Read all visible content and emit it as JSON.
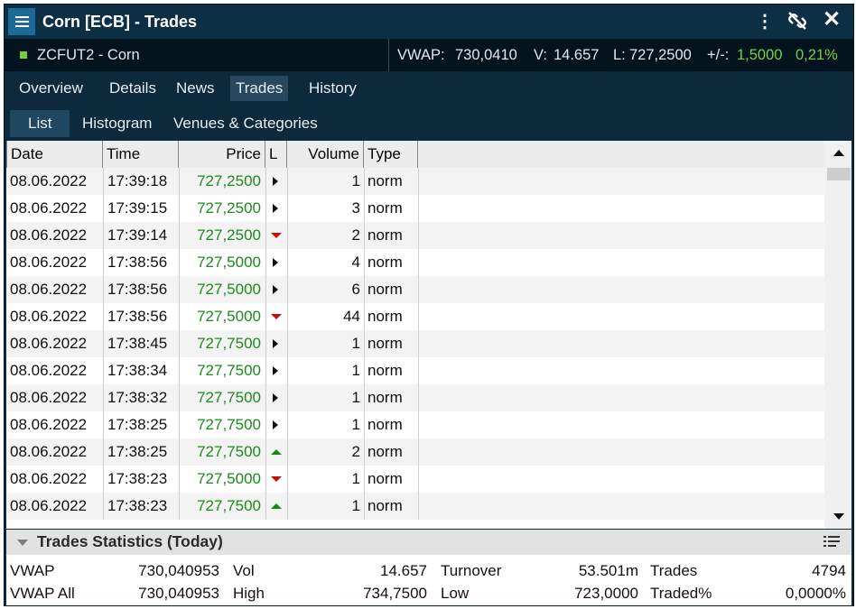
{
  "window": {
    "title": "Corn [ECB] - Trades",
    "icons": [
      "menu-icon",
      "more-vert-icon",
      "unlink-icon",
      "close-icon"
    ]
  },
  "quote": {
    "symbol": "ZCFUT2 - Corn",
    "vwap_label": "VWAP:",
    "vwap": "730,0410",
    "vol_label": "V:",
    "vol": "14.657",
    "last_label": "L:",
    "last": "727,2500",
    "change_label": "+/-:",
    "change": "1,5000",
    "change_pct": "0,21%",
    "change_color": "#6fd14a"
  },
  "tabs": [
    "Overview",
    "Details",
    "News",
    "Trades",
    "History"
  ],
  "active_tab": "Trades",
  "subtabs": [
    "List",
    "Histogram",
    "Venues & Categories"
  ],
  "active_subtab": "List",
  "table": {
    "columns": [
      "Date",
      "Time",
      "Price",
      "L",
      "Volume",
      "Type"
    ],
    "rows": [
      {
        "date": "08.06.2022",
        "time": "17:39:18",
        "price": "727,2500",
        "tick": "right",
        "volume": "1",
        "type": "norm"
      },
      {
        "date": "08.06.2022",
        "time": "17:39:15",
        "price": "727,2500",
        "tick": "right",
        "volume": "3",
        "type": "norm"
      },
      {
        "date": "08.06.2022",
        "time": "17:39:14",
        "price": "727,2500",
        "tick": "down",
        "volume": "2",
        "type": "norm"
      },
      {
        "date": "08.06.2022",
        "time": "17:38:56",
        "price": "727,5000",
        "tick": "right",
        "volume": "4",
        "type": "norm"
      },
      {
        "date": "08.06.2022",
        "time": "17:38:56",
        "price": "727,5000",
        "tick": "right",
        "volume": "6",
        "type": "norm"
      },
      {
        "date": "08.06.2022",
        "time": "17:38:56",
        "price": "727,5000",
        "tick": "down",
        "volume": "44",
        "type": "norm"
      },
      {
        "date": "08.06.2022",
        "time": "17:38:45",
        "price": "727,7500",
        "tick": "right",
        "volume": "1",
        "type": "norm"
      },
      {
        "date": "08.06.2022",
        "time": "17:38:34",
        "price": "727,7500",
        "tick": "right",
        "volume": "1",
        "type": "norm"
      },
      {
        "date": "08.06.2022",
        "time": "17:38:32",
        "price": "727,7500",
        "tick": "right",
        "volume": "1",
        "type": "norm"
      },
      {
        "date": "08.06.2022",
        "time": "17:38:25",
        "price": "727,7500",
        "tick": "right",
        "volume": "1",
        "type": "norm"
      },
      {
        "date": "08.06.2022",
        "time": "17:38:25",
        "price": "727,7500",
        "tick": "up",
        "volume": "2",
        "type": "norm"
      },
      {
        "date": "08.06.2022",
        "time": "17:38:23",
        "price": "727,5000",
        "tick": "down",
        "volume": "1",
        "type": "norm"
      },
      {
        "date": "08.06.2022",
        "time": "17:38:23",
        "price": "727,7500",
        "tick": "up",
        "volume": "1",
        "type": "norm"
      }
    ]
  },
  "stats": {
    "title": "Trades Statistics (Today)",
    "vwap_label": "VWAP",
    "vwap": "730,040953",
    "vol_label": "Vol",
    "vol": "14.657",
    "turnover_label": "Turnover",
    "turnover": "53.501m",
    "trades_label": "Trades",
    "trades": "4794",
    "vwap_all_label": "VWAP All",
    "vwap_all": "730,040953",
    "high_label": "High",
    "high": "734,7500",
    "low_label": "Low",
    "low": "723,0000",
    "traded_pct_label": "Traded%",
    "traded_pct": "0,0000%"
  }
}
